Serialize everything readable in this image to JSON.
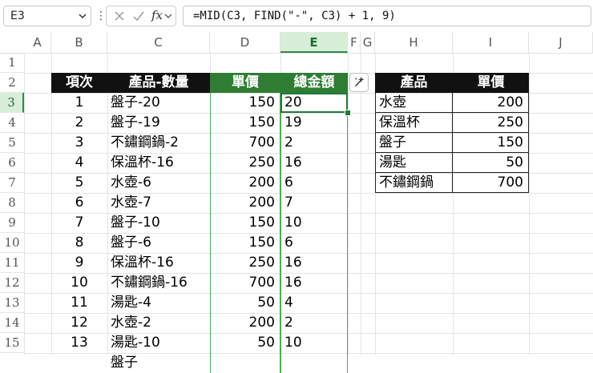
{
  "formula_bar": {
    "name_box": "E3",
    "formula": "=MID(C3, FIND(\"-\", C3) + 1, 9)",
    "cancel_icon": "x-icon",
    "enter_icon": "check-icon",
    "fx_label": "fx",
    "fx_chevron_icon": "chevron-down-icon"
  },
  "columns": [
    "A",
    "B",
    "C",
    "D",
    "E",
    "F",
    "G",
    "H",
    "I",
    "J"
  ],
  "selected_column": "E",
  "rows": [
    "1",
    "2",
    "3",
    "4",
    "5",
    "6",
    "7",
    "8",
    "9",
    "10",
    "11",
    "12",
    "13",
    "14",
    "15"
  ],
  "selected_row": "3",
  "table1": {
    "headers": [
      "項次",
      "產品-數量",
      "單價",
      "總金額"
    ],
    "rows": [
      [
        "1",
        "盤子-20",
        "150",
        "20"
      ],
      [
        "2",
        "盤子-19",
        "150",
        "19"
      ],
      [
        "3",
        "不鏽鋼鍋-2",
        "700",
        "2"
      ],
      [
        "4",
        "保溫杯-16",
        "250",
        "16"
      ],
      [
        "5",
        "水壺-6",
        "200",
        "6"
      ],
      [
        "6",
        "水壺-7",
        "200",
        "7"
      ],
      [
        "7",
        "盤子-10",
        "150",
        "10"
      ],
      [
        "8",
        "盤子-6",
        "150",
        "6"
      ],
      [
        "9",
        "保溫杯-16",
        "250",
        "16"
      ],
      [
        "10",
        "不鏽鋼鍋-16",
        "700",
        "16"
      ],
      [
        "11",
        "湯匙-4",
        "50",
        "4"
      ],
      [
        "12",
        "水壺-2",
        "200",
        "2"
      ],
      [
        "13",
        "湯匙-10",
        "50",
        "10"
      ],
      [
        "",
        "盤子",
        "",
        ""
      ]
    ]
  },
  "table2": {
    "headers": [
      "產品",
      "單價"
    ],
    "rows": [
      [
        "水壺",
        "200"
      ],
      [
        "保溫杯",
        "250"
      ],
      [
        "盤子",
        "150"
      ],
      [
        "湯匙",
        "50"
      ],
      [
        "不鏽鋼鍋",
        "700"
      ]
    ]
  },
  "colors": {
    "header_black": "#111111",
    "header_green": "#2e7d32",
    "selection_green": "#1e7a38"
  }
}
